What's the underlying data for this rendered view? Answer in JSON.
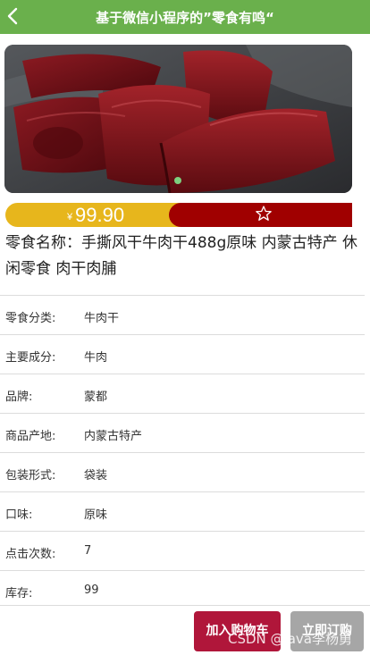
{
  "header": {
    "title": "基于微信小程序的”零食有鸣“",
    "back_icon": "chevron-left-icon"
  },
  "colors": {
    "header_bg": "#6ab04c",
    "price_bg": "#e7b61c",
    "fav_bg": "#a00000",
    "cart_btn": "#b0163a",
    "buy_btn": "#a6a6a6"
  },
  "product": {
    "image": "dried-beef-jerky-photo",
    "price_symbol": "¥",
    "price": "99.90",
    "favorite_icon": "star-outline-icon",
    "name": "零食名称：手撕风干牛肉干488g原味 内蒙古特产 休闲零食 肉干肉脯"
  },
  "details": [
    {
      "label": "零食分类:",
      "value": "牛肉干"
    },
    {
      "label": "主要成分:",
      "value": "牛肉"
    },
    {
      "label": "品牌:",
      "value": "蒙都"
    },
    {
      "label": "商品产地:",
      "value": "内蒙古特产"
    },
    {
      "label": "包装形式:",
      "value": "袋装"
    },
    {
      "label": "口味:",
      "value": "原味"
    },
    {
      "label": "点击次数:",
      "value": "7"
    },
    {
      "label": "库存:",
      "value": "99"
    }
  ],
  "actions": {
    "add_to_cart": "加入购物车",
    "buy_now": "立即订购"
  },
  "watermark": "CSDN @java李杨勇"
}
